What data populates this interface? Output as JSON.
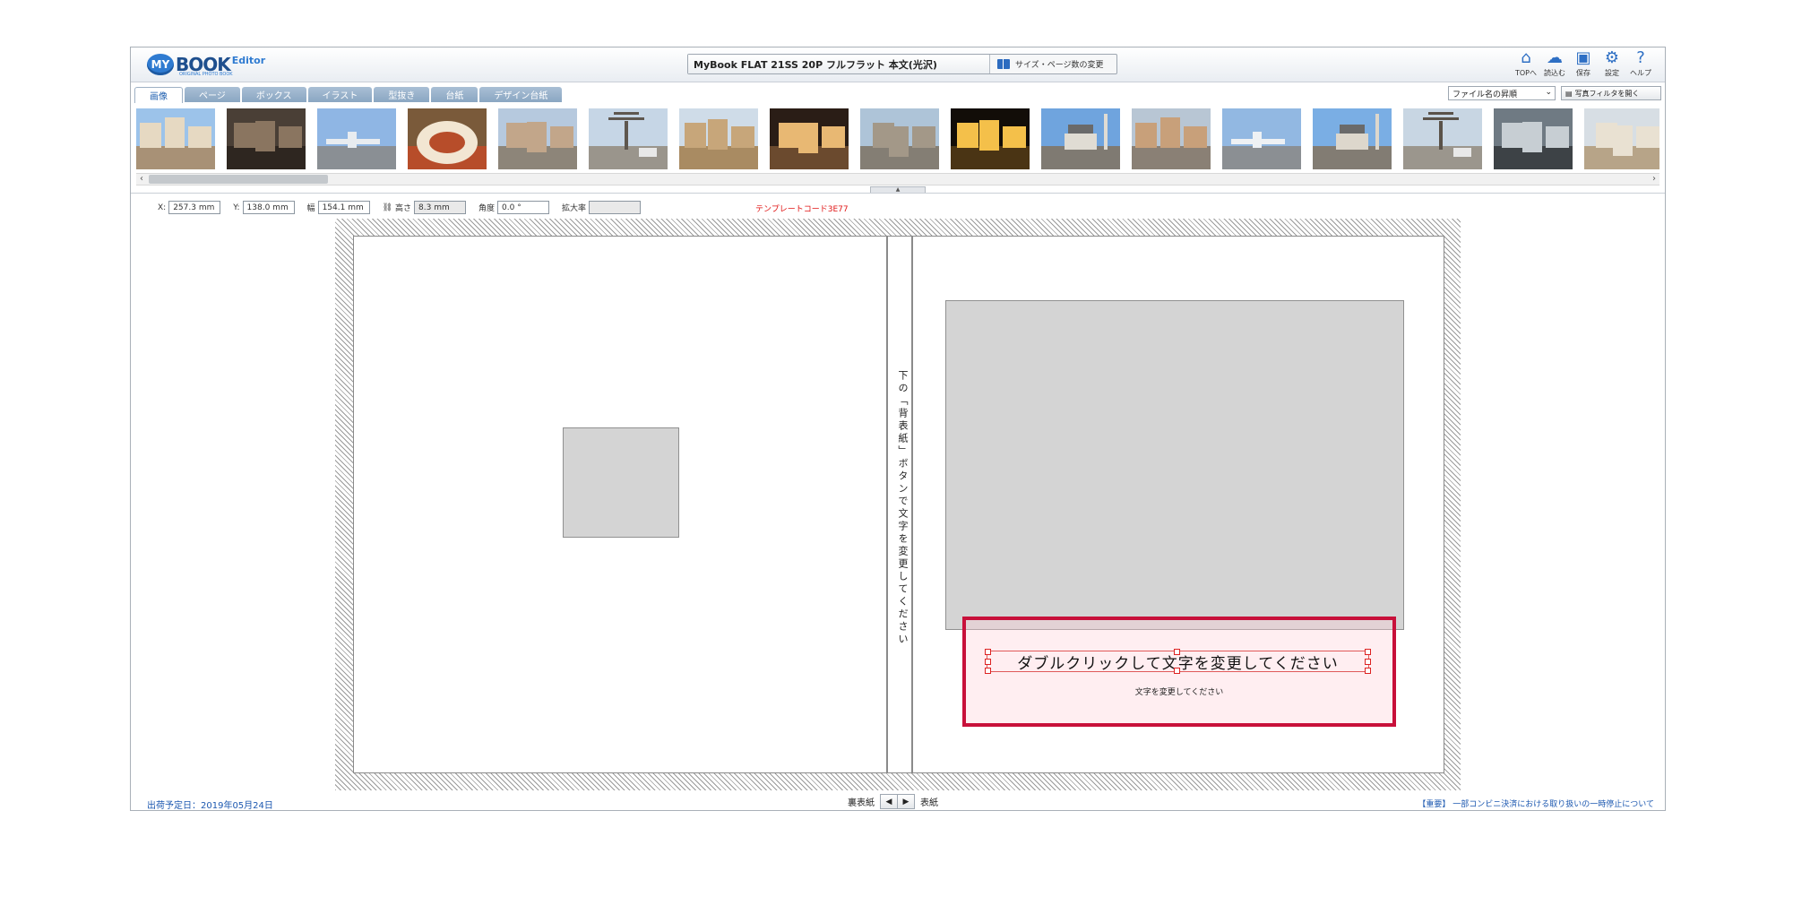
{
  "header": {
    "logo_badge": "MY",
    "logo_book": "BOOK",
    "logo_editor": "Editor",
    "logo_sub": "ORIGINAL PHOTO BOOK",
    "book_title": "MyBook FLAT 21SS 20P フルフラット 本文(光沢)",
    "size_button": "サイズ・ページ数の変更"
  },
  "top_icons": [
    {
      "name": "home-icon",
      "glyph": "⌂",
      "label": "TOPへ"
    },
    {
      "name": "load-icon",
      "glyph": "☁",
      "label": "読込む"
    },
    {
      "name": "save-icon",
      "glyph": "▣",
      "label": "保存"
    },
    {
      "name": "settings-icon",
      "glyph": "⚙",
      "label": "設定"
    },
    {
      "name": "help-icon",
      "glyph": "?",
      "label": "ヘルプ"
    }
  ],
  "tabs": [
    "画像",
    "ページ",
    "ボックス",
    "イラスト",
    "型抜き",
    "台紙",
    "デザイン台紙"
  ],
  "active_tab_index": 0,
  "sort_select": "ファイル名の昇順",
  "filter_button": "写真フィルタを開く",
  "thumbnails": [
    {
      "kind": "palace",
      "sky": "#9cc3ea",
      "ground": "#a89176",
      "accent": "#e6d9c2"
    },
    {
      "kind": "door",
      "sky": "#4a3f36",
      "ground": "#2e2620",
      "accent": "#8a7560"
    },
    {
      "kind": "plane",
      "sky": "#8fb6e4",
      "ground": "#8a8f94",
      "accent": "#e8ecf0"
    },
    {
      "kind": "food",
      "sky": "#7a5a3a",
      "ground": "#b74d2a",
      "accent": "#f2e6d2"
    },
    {
      "kind": "street",
      "sky": "#b6c9de",
      "ground": "#8d8579",
      "accent": "#c2a68a"
    },
    {
      "kind": "tree",
      "sky": "#c6d6e6",
      "ground": "#9a958c",
      "accent": "#5e574f"
    },
    {
      "kind": "colosseum",
      "sky": "#cfdce8",
      "ground": "#a98b62",
      "accent": "#c7a67a"
    },
    {
      "kind": "mosque-inside",
      "sky": "#2a1d16",
      "ground": "#6b4a2e",
      "accent": "#e8b873"
    },
    {
      "kind": "plaza",
      "sky": "#aec4d8",
      "ground": "#847e74",
      "accent": "#a39888"
    },
    {
      "kind": "night",
      "sky": "#120d08",
      "ground": "#4a3414",
      "accent": "#f4c04a"
    },
    {
      "kind": "fountain",
      "sky": "#6fa4de",
      "ground": "#7f7a72",
      "accent": "#e0dcd3"
    },
    {
      "kind": "street2",
      "sky": "#b8c6d4",
      "ground": "#8a8075",
      "accent": "#c8a07a"
    },
    {
      "kind": "plane2",
      "sky": "#92b8e2",
      "ground": "#8b8f93",
      "accent": "#eef1f4"
    },
    {
      "kind": "fountain2",
      "sky": "#7aaee4",
      "ground": "#827c73",
      "accent": "#ddd7cc"
    },
    {
      "kind": "tree2",
      "sky": "#c8d6e3",
      "ground": "#9b968d",
      "accent": "#5a5249"
    },
    {
      "kind": "building",
      "sky": "#6f7a83",
      "ground": "#3d4246",
      "accent": "#c7ced3"
    },
    {
      "kind": "arch",
      "sky": "#d7dee4",
      "ground": "#b7a488",
      "accent": "#e9e1d2"
    }
  ],
  "props": {
    "x_label": "X:",
    "x_value": "257.3 mm",
    "y_label": "Y:",
    "y_value": "138.0 mm",
    "width_label": "幅",
    "width_value": "154.1 mm",
    "height_label": "高さ",
    "height_value": "8.3 mm",
    "angle_label": "角度",
    "angle_value": "0.0 °",
    "scale_label": "拡大率",
    "scale_value": ""
  },
  "template_code": "テンプレートコード3E77",
  "spine_text": "下の「背表紙」ボタンで文字を変更してください",
  "title_text": "ダブルクリックして文字を変更してください",
  "subtitle_text": "文字を変更してください",
  "footer": {
    "ship_date": "出荷予定日：2019年05月24日",
    "back_cover": "裏表紙",
    "prev": "◀",
    "next": "▶",
    "front_cover": "表紙",
    "notice": "【重要】 一部コンビニ決済における取り扱いの一時停止について"
  }
}
